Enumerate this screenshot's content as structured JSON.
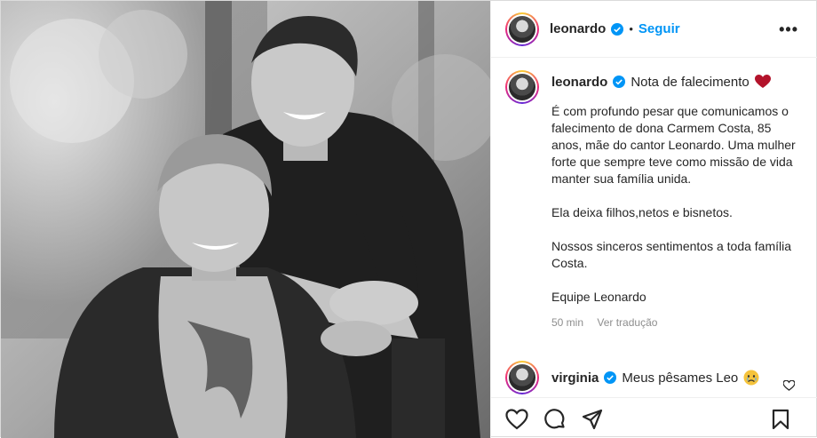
{
  "header": {
    "username": "leonardo",
    "separator": "•",
    "follow_label": "Seguir",
    "more_label": "•••"
  },
  "caption": {
    "username": "leonardo",
    "title": "Nota de falecimento",
    "paragraphs": [
      "É com profundo pesar que comunicamos o falecimento de dona Carmem Costa, 85 anos, mãe do cantor Leonardo. Uma mulher forte que sempre teve como missão de vida manter sua família unida.",
      "Ela deixa filhos,netos e bisnetos.",
      "Nossos sinceros sentimentos a toda família Costa.",
      "Equipe Leonardo"
    ],
    "time": "50 min",
    "translate_label": "Ver tradução"
  },
  "comment": {
    "username": "virginia",
    "text": "Meus pêsames Leo"
  },
  "icons": {
    "verified": "verified-badge-icon",
    "heart": "red-heart-emoji",
    "like": "heart-outline-icon",
    "comment": "comment-bubble-icon",
    "share": "paper-plane-icon",
    "save": "bookmark-icon"
  },
  "colors": {
    "accent": "#0095f6",
    "text": "#262626",
    "muted": "#8e8e8e",
    "heart": "#ed4956"
  }
}
